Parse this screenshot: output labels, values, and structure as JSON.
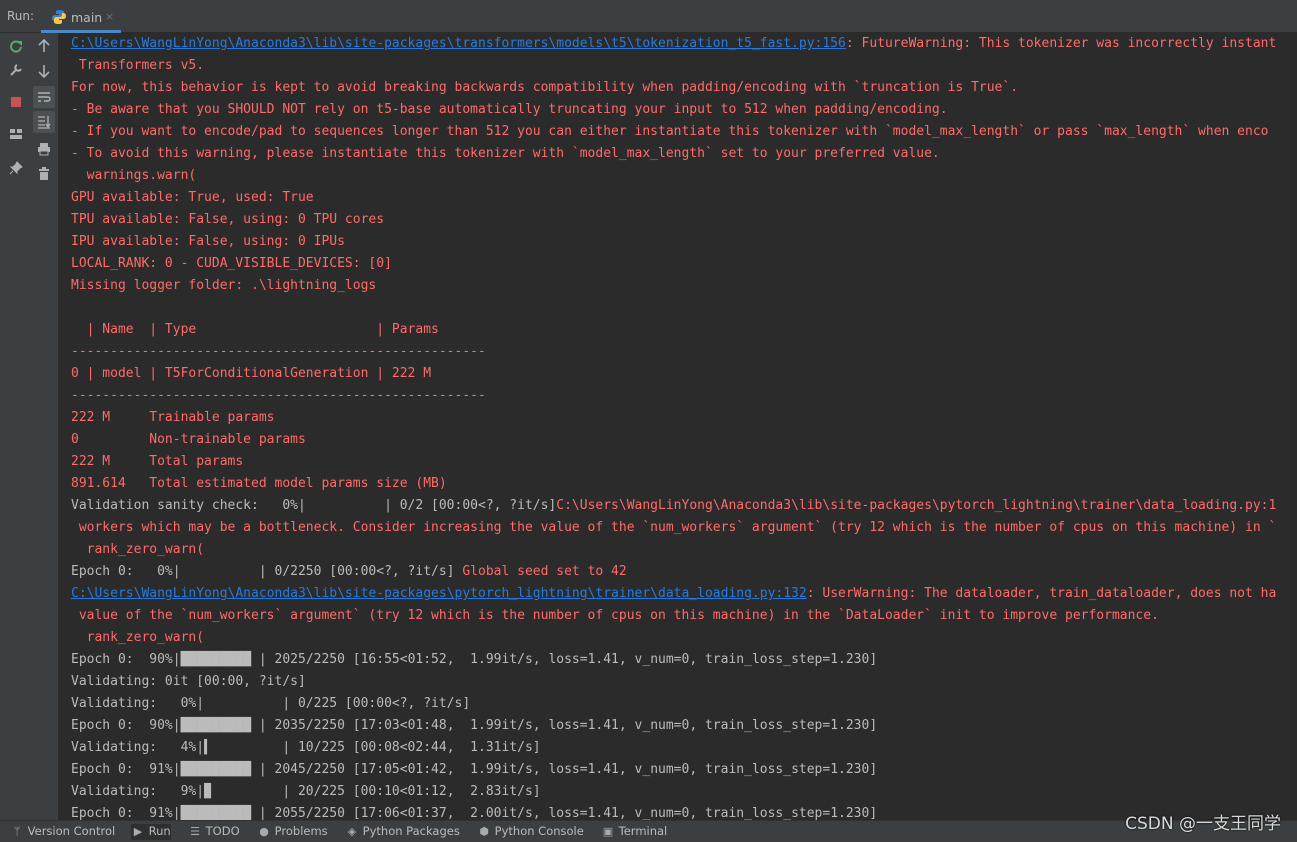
{
  "run_panel": {
    "label": "Run:",
    "tab": {
      "name": "main",
      "close": "×"
    }
  },
  "toolbar_left": [
    "rerun-icon",
    "wrench-icon",
    "stop-icon",
    "layout-icon",
    "pin-icon"
  ],
  "toolbar_right": [
    "arrow-up-icon",
    "arrow-down-icon",
    "soft-wrap-icon",
    "scroll-to-end-icon",
    "print-icon",
    "trash-icon"
  ],
  "console": {
    "lines": [
      {
        "parts": [
          {
            "t": "C:\\Users\\WangLinYong\\Anaconda3\\lib\\site-packages\\transformers\\models\\t5\\tokenization_t5_fast.py:156",
            "c": "link"
          },
          {
            "t": ": FutureWarning: This tokenizer was incorrectly instant",
            "c": "err"
          }
        ]
      },
      {
        "parts": [
          {
            "t": " Transformers v5.",
            "c": "err"
          }
        ]
      },
      {
        "parts": [
          {
            "t": "For now, this behavior is kept to avoid breaking backwards compatibility when padding/encoding with `truncation is True`.",
            "c": "err"
          }
        ]
      },
      {
        "parts": [
          {
            "t": "- Be aware that you SHOULD NOT rely on t5-base automatically truncating your input to 512 when padding/encoding.",
            "c": "err"
          }
        ]
      },
      {
        "parts": [
          {
            "t": "- If you want to encode/pad to sequences longer than 512 you can either instantiate this tokenizer with `model_max_length` or pass `max_length` when enco",
            "c": "err"
          }
        ]
      },
      {
        "parts": [
          {
            "t": "- To avoid this warning, please instantiate this tokenizer with `model_max_length` set to your preferred value.",
            "c": "err"
          }
        ]
      },
      {
        "parts": [
          {
            "t": "  warnings.warn(",
            "c": "err"
          }
        ]
      },
      {
        "parts": [
          {
            "t": "GPU available: True, used: True",
            "c": "err"
          }
        ]
      },
      {
        "parts": [
          {
            "t": "TPU available: False, using: 0 TPU cores",
            "c": "err"
          }
        ]
      },
      {
        "parts": [
          {
            "t": "IPU available: False, using: 0 IPUs",
            "c": "err"
          }
        ]
      },
      {
        "parts": [
          {
            "t": "LOCAL_RANK: 0 - CUDA_VISIBLE_DEVICES: [0]",
            "c": "err"
          }
        ]
      },
      {
        "parts": [
          {
            "t": "Missing logger folder: .\\lightning_logs",
            "c": "err"
          }
        ]
      },
      {
        "parts": [
          {
            "t": "",
            "c": "err"
          }
        ]
      },
      {
        "parts": [
          {
            "t": "  | Name  | Type                       | Params",
            "c": "err"
          }
        ]
      },
      {
        "parts": [
          {
            "t": "-----------------------------------------------------",
            "c": "err"
          }
        ]
      },
      {
        "parts": [
          {
            "t": "0 | model | T5ForConditionalGeneration | 222 M",
            "c": "err"
          }
        ]
      },
      {
        "parts": [
          {
            "t": "-----------------------------------------------------",
            "c": "err"
          }
        ]
      },
      {
        "parts": [
          {
            "t": "222 M     Trainable params",
            "c": "err"
          }
        ]
      },
      {
        "parts": [
          {
            "t": "0         Non-trainable params",
            "c": "err"
          }
        ]
      },
      {
        "parts": [
          {
            "t": "222 M     Total params",
            "c": "err"
          }
        ]
      },
      {
        "parts": [
          {
            "t": "891.614   Total estimated model params size (MB)",
            "c": "err"
          }
        ]
      },
      {
        "parts": [
          {
            "t": "Validation sanity check:   0%|          | 0/2 [00:00<?, ?it/s]",
            "c": "out"
          },
          {
            "t": "C:\\Users\\WangLinYong\\Anaconda3\\lib\\site-packages\\pytorch_lightning\\trainer\\data_loading.py:1",
            "c": "err"
          }
        ]
      },
      {
        "parts": [
          {
            "t": " workers which may be a bottleneck. Consider increasing the value of the `num_workers` argument` (try 12 which is the number of cpus on this machine) in `",
            "c": "err"
          }
        ]
      },
      {
        "parts": [
          {
            "t": "  rank_zero_warn(",
            "c": "err"
          }
        ]
      },
      {
        "parts": [
          {
            "t": "Epoch 0:   0%|          | 0/2250 [00:00<?, ?it/s] ",
            "c": "out"
          },
          {
            "t": "Global seed set to 42",
            "c": "err"
          }
        ]
      },
      {
        "parts": [
          {
            "t": "C:\\Users\\WangLinYong\\Anaconda3\\lib\\site-packages\\pytorch_lightning\\trainer\\data_loading.py:132",
            "c": "link"
          },
          {
            "t": ": UserWarning: The dataloader, train_dataloader, does not ha",
            "c": "err"
          }
        ]
      },
      {
        "parts": [
          {
            "t": " value of the `num_workers` argument` (try 12 which is the number of cpus on this machine) in the `DataLoader` init to improve performance.",
            "c": "err"
          }
        ]
      },
      {
        "parts": [
          {
            "t": "  rank_zero_warn(",
            "c": "err"
          }
        ]
      },
      {
        "parts": [
          {
            "t": "Epoch 0:  90%|",
            "c": "out"
          },
          {
            "t": "█████████",
            "c": "bar"
          },
          {
            "t": " | 2025/2250 [16:55<01:52,  1.99it/s, loss=1.41, v_num=0, train_loss_step=1.230]",
            "c": "out"
          }
        ]
      },
      {
        "parts": [
          {
            "t": "Validating: 0it [00:00, ?it/s]",
            "c": "out"
          }
        ]
      },
      {
        "parts": [
          {
            "t": "Validating:   0%|          | 0/225 [00:00<?, ?it/s]",
            "c": "out"
          }
        ]
      },
      {
        "parts": [
          {
            "t": "Epoch 0:  90%|",
            "c": "out"
          },
          {
            "t": "█████████",
            "c": "bar"
          },
          {
            "t": " | 2035/2250 [17:03<01:48,  1.99it/s, loss=1.41, v_num=0, train_loss_step=1.230]",
            "c": "out"
          }
        ]
      },
      {
        "parts": [
          {
            "t": "Validating:   4%|",
            "c": "out"
          },
          {
            "t": "▍",
            "c": "bar"
          },
          {
            "t": "         | 10/225 [00:08<02:44,  1.31it/s]",
            "c": "out"
          }
        ]
      },
      {
        "parts": [
          {
            "t": "Epoch 0:  91%|",
            "c": "out"
          },
          {
            "t": "█████████",
            "c": "bar"
          },
          {
            "t": " | 2045/2250 [17:05<01:42,  1.99it/s, loss=1.41, v_num=0, train_loss_step=1.230]",
            "c": "out"
          }
        ]
      },
      {
        "parts": [
          {
            "t": "Validating:   9%|",
            "c": "out"
          },
          {
            "t": "▉",
            "c": "bar"
          },
          {
            "t": "         | 20/225 [00:10<01:12,  2.83it/s]",
            "c": "out"
          }
        ]
      },
      {
        "parts": [
          {
            "t": "Epoch 0:  91%|",
            "c": "out"
          },
          {
            "t": "█████████",
            "c": "bar"
          },
          {
            "t": " | 2055/2250 [17:06<01:37,  2.00it/s, loss=1.41, v_num=0, train_loss_step=1.230]",
            "c": "out"
          }
        ]
      }
    ]
  },
  "statusbar": {
    "items": [
      {
        "label": "Version Control",
        "icon": "branch-icon"
      },
      {
        "label": "Run",
        "icon": "run-icon"
      },
      {
        "label": "TODO",
        "icon": "todo-icon"
      },
      {
        "label": "Problems",
        "icon": "problems-icon"
      },
      {
        "label": "Python Packages",
        "icon": "packages-icon"
      },
      {
        "label": "Python Console",
        "icon": "python-console-icon"
      },
      {
        "label": "Terminal",
        "icon": "terminal-icon"
      }
    ]
  },
  "watermark": "CSDN @一支王同学",
  "colors": {
    "error": "#ff6b68",
    "link": "#287bde",
    "output": "#bbbbbb",
    "background": "#2b2b2b"
  }
}
